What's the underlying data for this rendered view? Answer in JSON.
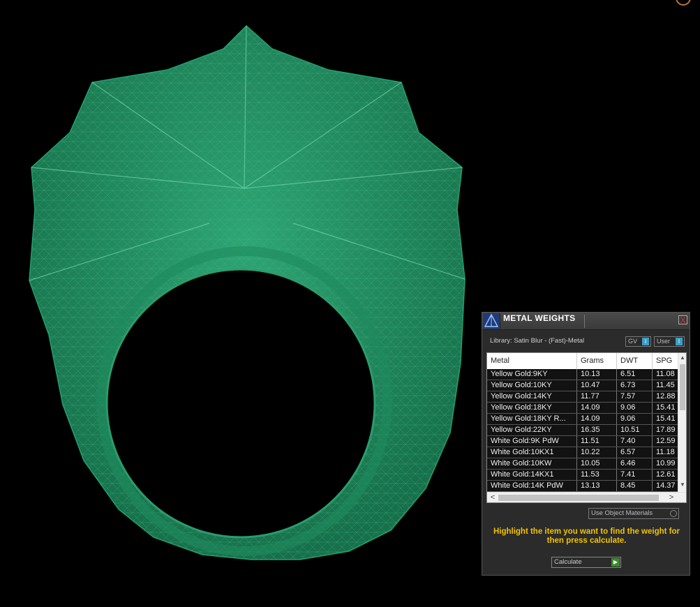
{
  "panel": {
    "title": "METAL WEIGHTS",
    "close_label": "X",
    "library_label": "Library: Satin Blur - (Fast)-Metal",
    "gv_toggle": {
      "label": "GV",
      "indicator": "I"
    },
    "user_toggle": {
      "label": "User",
      "indicator": "I"
    },
    "table": {
      "columns": [
        "Metal",
        "Grams",
        "DWT",
        "SPG"
      ],
      "rows": [
        [
          "Yellow Gold:9KY",
          "10.13",
          "6.51",
          "11.08"
        ],
        [
          "Yellow Gold:10KY",
          "10.47",
          "6.73",
          "11.45"
        ],
        [
          "Yellow Gold:14KY",
          "11.77",
          "7.57",
          "12.88"
        ],
        [
          "Yellow Gold:18KY",
          "14.09",
          "9.06",
          "15.41"
        ],
        [
          "Yellow Gold:18KY R...",
          "14.09",
          "9.06",
          "15.41"
        ],
        [
          "Yellow Gold:22KY",
          "16.35",
          "10.51",
          "17.89"
        ],
        [
          "White Gold:9K PdW",
          "11.51",
          "7.40",
          "12.59"
        ],
        [
          "White Gold:10KX1",
          "10.22",
          "6.57",
          "11.18"
        ],
        [
          "White Gold:10KW",
          "10.05",
          "6.46",
          "10.99"
        ],
        [
          "White Gold:14KX1",
          "11.53",
          "7.41",
          "12.61"
        ],
        [
          "White Gold:14K PdW",
          "13.13",
          "8.45",
          "14.37"
        ]
      ]
    },
    "use_object_materials_label": "Use Object Materials",
    "hint": "Highlight the item you want to find the weight for then press calculate.",
    "calculate_label": "Calculate"
  },
  "colors": {
    "background": "#000000",
    "mesh": "#1f8f63",
    "hint": "#f2c300",
    "toggle_indicator": "#3c9dc9",
    "calculate_go": "#3c8a2e"
  },
  "icons": {
    "panel_icon": "matrix-logo-icon",
    "corner_icon": "compass-icon"
  }
}
